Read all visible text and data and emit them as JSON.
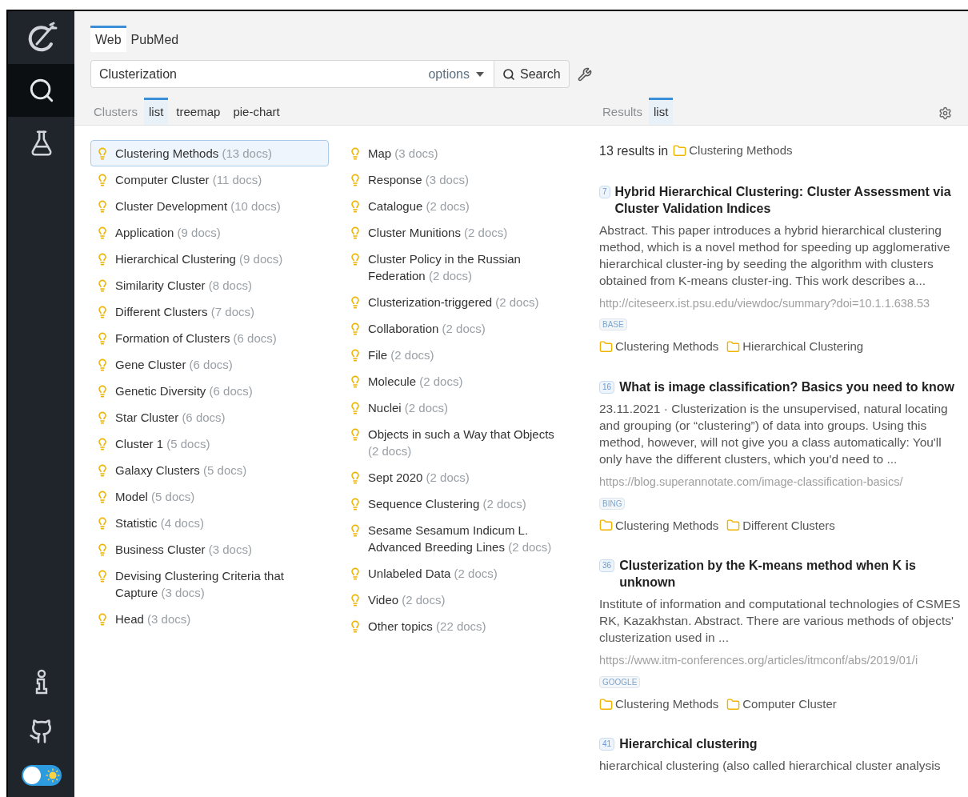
{
  "sidebar": {
    "items": [
      {
        "kind": "logo",
        "selected": false
      },
      {
        "kind": "search",
        "selected": true
      },
      {
        "kind": "flask",
        "selected": false
      }
    ],
    "bottom": [
      {
        "kind": "info"
      },
      {
        "kind": "github"
      }
    ],
    "theme_toggle": {
      "on": true
    }
  },
  "source_tabs": [
    {
      "label": "Web",
      "selected": true
    },
    {
      "label": "PubMed",
      "selected": false
    }
  ],
  "search": {
    "value": "Clusterization",
    "options": "options",
    "button": "Search"
  },
  "clusters_view": {
    "label": "Clusters",
    "tabs": [
      {
        "label": "list",
        "selected": true
      },
      {
        "label": "treemap",
        "selected": false
      },
      {
        "label": "pie-chart",
        "selected": false
      }
    ]
  },
  "results_view": {
    "label": "Results",
    "tabs": [
      {
        "label": "list",
        "selected": true
      }
    ]
  },
  "clusters": [
    [
      {
        "name": "Clustering Methods",
        "count": "(13 docs)",
        "selected": true
      },
      {
        "name": "Computer Cluster",
        "count": "(11 docs)",
        "selected": false
      },
      {
        "name": "Cluster Development",
        "count": "(10 docs)",
        "selected": false
      },
      {
        "name": "Application",
        "count": "(9 docs)",
        "selected": false
      },
      {
        "name": "Hierarchical Clustering",
        "count": "(9 docs)",
        "selected": false
      },
      {
        "name": "Similarity Cluster",
        "count": "(8 docs)",
        "selected": false
      },
      {
        "name": "Different Clusters",
        "count": "(7 docs)",
        "selected": false
      },
      {
        "name": "Formation of Clusters",
        "count": "(6 docs)",
        "selected": false
      },
      {
        "name": "Gene Cluster",
        "count": "(6 docs)",
        "selected": false
      },
      {
        "name": "Genetic Diversity",
        "count": "(6 docs)",
        "selected": false
      },
      {
        "name": "Star Cluster",
        "count": "(6 docs)",
        "selected": false
      },
      {
        "name": "Cluster 1",
        "count": "(5 docs)",
        "selected": false
      },
      {
        "name": "Galaxy Clusters",
        "count": "(5 docs)",
        "selected": false
      },
      {
        "name": "Model",
        "count": "(5 docs)",
        "selected": false
      },
      {
        "name": "Statistic",
        "count": "(4 docs)",
        "selected": false
      },
      {
        "name": "Business Cluster",
        "count": "(3 docs)",
        "selected": false
      },
      {
        "name": "Devising Clustering Criteria that Capture",
        "count": "(3 docs)",
        "selected": false
      },
      {
        "name": "Head",
        "count": "(3 docs)",
        "selected": false
      }
    ],
    [
      {
        "name": "Map",
        "count": "(3 docs)",
        "selected": false
      },
      {
        "name": "Response",
        "count": "(3 docs)",
        "selected": false
      },
      {
        "name": "Catalogue",
        "count": "(2 docs)",
        "selected": false
      },
      {
        "name": "Cluster Munitions",
        "count": "(2 docs)",
        "selected": false
      },
      {
        "name": "Cluster Policy in the Russian Federation",
        "count": "(2 docs)",
        "selected": false
      },
      {
        "name": "Clusterization-triggered",
        "count": "(2 docs)",
        "selected": false
      },
      {
        "name": "Collaboration",
        "count": "(2 docs)",
        "selected": false
      },
      {
        "name": "File",
        "count": "(2 docs)",
        "selected": false
      },
      {
        "name": "Molecule",
        "count": "(2 docs)",
        "selected": false
      },
      {
        "name": "Nuclei",
        "count": "(2 docs)",
        "selected": false
      },
      {
        "name": "Objects in such a Way that Objects",
        "count": "(2 docs)",
        "selected": false
      },
      {
        "name": "Sept 2020",
        "count": "(2 docs)",
        "selected": false
      },
      {
        "name": "Sequence Clustering",
        "count": "(2 docs)",
        "selected": false
      },
      {
        "name": "Sesame Sesamum Indicum L. Advanced Breeding Lines",
        "count": "(2 docs)",
        "selected": false
      },
      {
        "name": "Unlabeled Data",
        "count": "(2 docs)",
        "selected": false
      },
      {
        "name": "Video",
        "count": "(2 docs)",
        "selected": false
      },
      {
        "name": "Other topics",
        "count": "(22 docs)",
        "selected": false
      }
    ]
  ],
  "results_summary": {
    "text": "13 results in",
    "folder": "Clustering Methods"
  },
  "results": [
    {
      "rank": "7",
      "title": "Hybrid Hierarchical Clustering: Cluster Assessment via Cluster Validation Indices",
      "snippet": "Abstract. This paper introduces a hybrid hierarchical clustering method, which is a novel method for speeding up agglomerative hierarchical cluster-ing by seeding the algorithm with clusters obtained from K-means cluster-ing. This work describes a...",
      "url": "http://citeseerx.ist.psu.edu/viewdoc/summary?doi=10.1.1.638.53",
      "source": "BASE",
      "folders": [
        "Clustering Methods",
        "Hierarchical Clustering"
      ]
    },
    {
      "rank": "16",
      "title": "What is image classification? Basics you need to know",
      "snippet": "23.11.2021 · Clusterization is the unsupervised, natural locating and grouping (or “clustering”) of data into groups. Using this method, however, will not give you a class automatically: You'll only have the different clusters, which you'd need to ...",
      "url": "https://blog.superannotate.com/image-classification-basics/",
      "source": "BING",
      "folders": [
        "Clustering Methods",
        "Different Clusters"
      ]
    },
    {
      "rank": "36",
      "title": "Clusterization by the K-means method when K is unknown",
      "snippet": "Institute of information and computational technologies of CSMES RK, Kazakhstan. Abstract. There are various methods of objects' clusterization used in ...",
      "url": "https://www.itm-conferences.org/articles/itmconf/abs/2019/01/i",
      "source": "GOOGLE",
      "folders": [
        "Clustering Methods",
        "Computer Cluster"
      ]
    },
    {
      "rank": "41",
      "title": "Hierarchical clustering",
      "snippet": "hierarchical clustering (also called hierarchical cluster analysis"
    }
  ]
}
